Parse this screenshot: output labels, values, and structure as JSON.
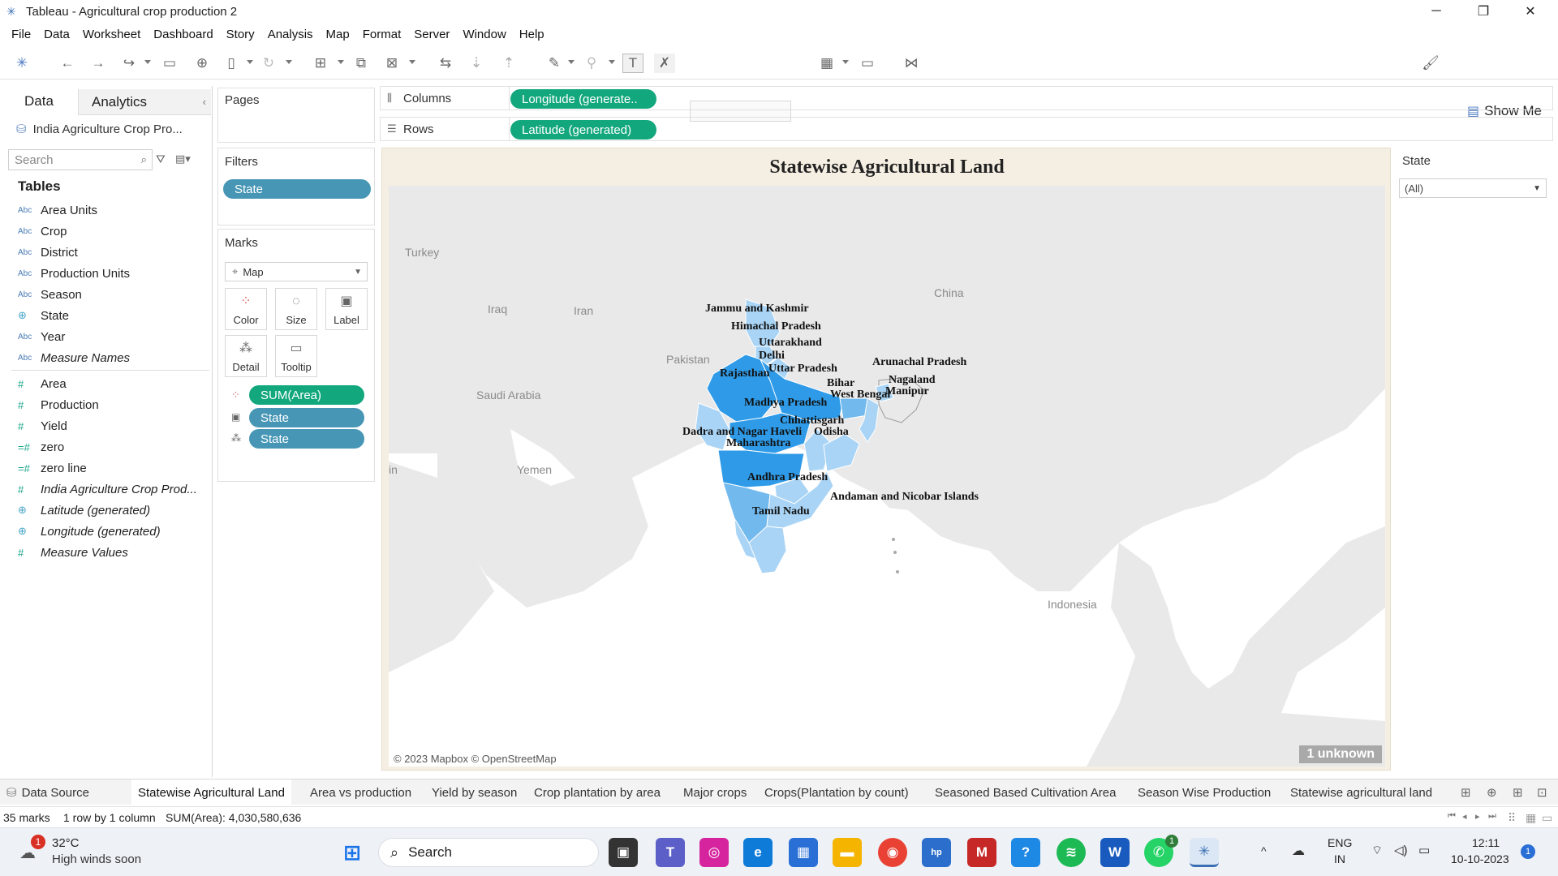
{
  "window": {
    "title": "Tableau - Agricultural crop production 2",
    "minimize": "─",
    "restore": "❐",
    "close": "✕"
  },
  "menu": [
    "File",
    "Data",
    "Worksheet",
    "Dashboard",
    "Story",
    "Analysis",
    "Map",
    "Format",
    "Server",
    "Window",
    "Help"
  ],
  "toolbar": {
    "show_me": "Show Me"
  },
  "data_pane": {
    "tab_data": "Data",
    "tab_analytics": "Analytics",
    "datasource": "India Agriculture Crop Pro...",
    "search_placeholder": "Search",
    "tables_heading": "Tables",
    "fields": [
      {
        "name": "Area Units",
        "type": "Abc"
      },
      {
        "name": "Crop",
        "type": "Abc"
      },
      {
        "name": "District",
        "type": "Abc"
      },
      {
        "name": "Production Units",
        "type": "Abc"
      },
      {
        "name": "Season",
        "type": "Abc"
      },
      {
        "name": "State",
        "type": "geo"
      },
      {
        "name": "Year",
        "type": "Abc"
      },
      {
        "name": "Measure Names",
        "type": "Abc"
      },
      {
        "name": "Area",
        "type": "#"
      },
      {
        "name": "Production",
        "type": "#"
      },
      {
        "name": "Yield",
        "type": "#"
      },
      {
        "name": "zero",
        "type": "#"
      },
      {
        "name": "zero line",
        "type": "#"
      },
      {
        "name": "India Agriculture Crop Prod...",
        "type": "#"
      },
      {
        "name": "Latitude (generated)",
        "type": "geo"
      },
      {
        "name": "Longitude (generated)",
        "type": "geo"
      },
      {
        "name": "Measure Values",
        "type": "#"
      }
    ]
  },
  "cards": {
    "pages": "Pages",
    "filters": "Filters",
    "filter_pill": "State",
    "marks": "Marks",
    "mark_type": "Map",
    "mark_buttons": [
      "Color",
      "Size",
      "Label",
      "Detail",
      "Tooltip"
    ],
    "mark_pills": [
      "SUM(Area)",
      "State",
      "State"
    ]
  },
  "shelves": {
    "columns_label": "Columns",
    "columns_pill": "Longitude (generate..",
    "rows_label": "Rows",
    "rows_pill": "Latitude (generated)"
  },
  "viz": {
    "title": "Statewise Agricultural Land",
    "countries": [
      "Turkey",
      "Iraq",
      "Iran",
      "China",
      "Pakistan",
      "Saudi Arabia",
      "Yemen",
      "Indonesia",
      "in"
    ],
    "state_labels": [
      "Jammu and Kashmir",
      "Himachal Pradesh",
      "Uttarakhand",
      "Delhi",
      "Uttar Pradesh",
      "Rajasthan",
      "Arunachal Pradesh",
      "Nagaland",
      "Manipur",
      "Bihar",
      "West Bengal",
      "Madhya Pradesh",
      "Chhattisgarh",
      "Odisha",
      "Dadra and Nagar Haveli",
      "Maharashtra",
      "Andhra Pradesh",
      "Andaman and Nicobar Islands",
      "Tamil Nadu"
    ],
    "attribution": "© 2023 Mapbox © OpenStreetMap",
    "unknown_badge": "1 unknown",
    "colors": {
      "light": "#a9d4f5",
      "medium": "#72b9ee",
      "dark": "#2f9be8"
    }
  },
  "state_filter": {
    "title": "State",
    "value": "(All)"
  },
  "sheet_tabs": [
    "Data Source",
    "Statewise Agricultural Land",
    "Area vs production",
    "Yield by season",
    "Crop plantation by area",
    "Major crops",
    "Crops(Plantation by count)",
    "Seasoned  Based Cultivation Area",
    "Season Wise Production",
    "Statewise agricultural land"
  ],
  "status": {
    "marks": "35 marks",
    "dims": "1 row by 1 column",
    "sum": "SUM(Area): 4,030,580,636"
  },
  "taskbar": {
    "weather_temp": "32°C",
    "weather_note": "High winds soon",
    "weather_badge": "1",
    "search": "Search",
    "lang": "ENG",
    "region": "IN",
    "time": "12:11",
    "date": "10-10-2023",
    "notif": "1",
    "whatsapp_badge": "1"
  }
}
